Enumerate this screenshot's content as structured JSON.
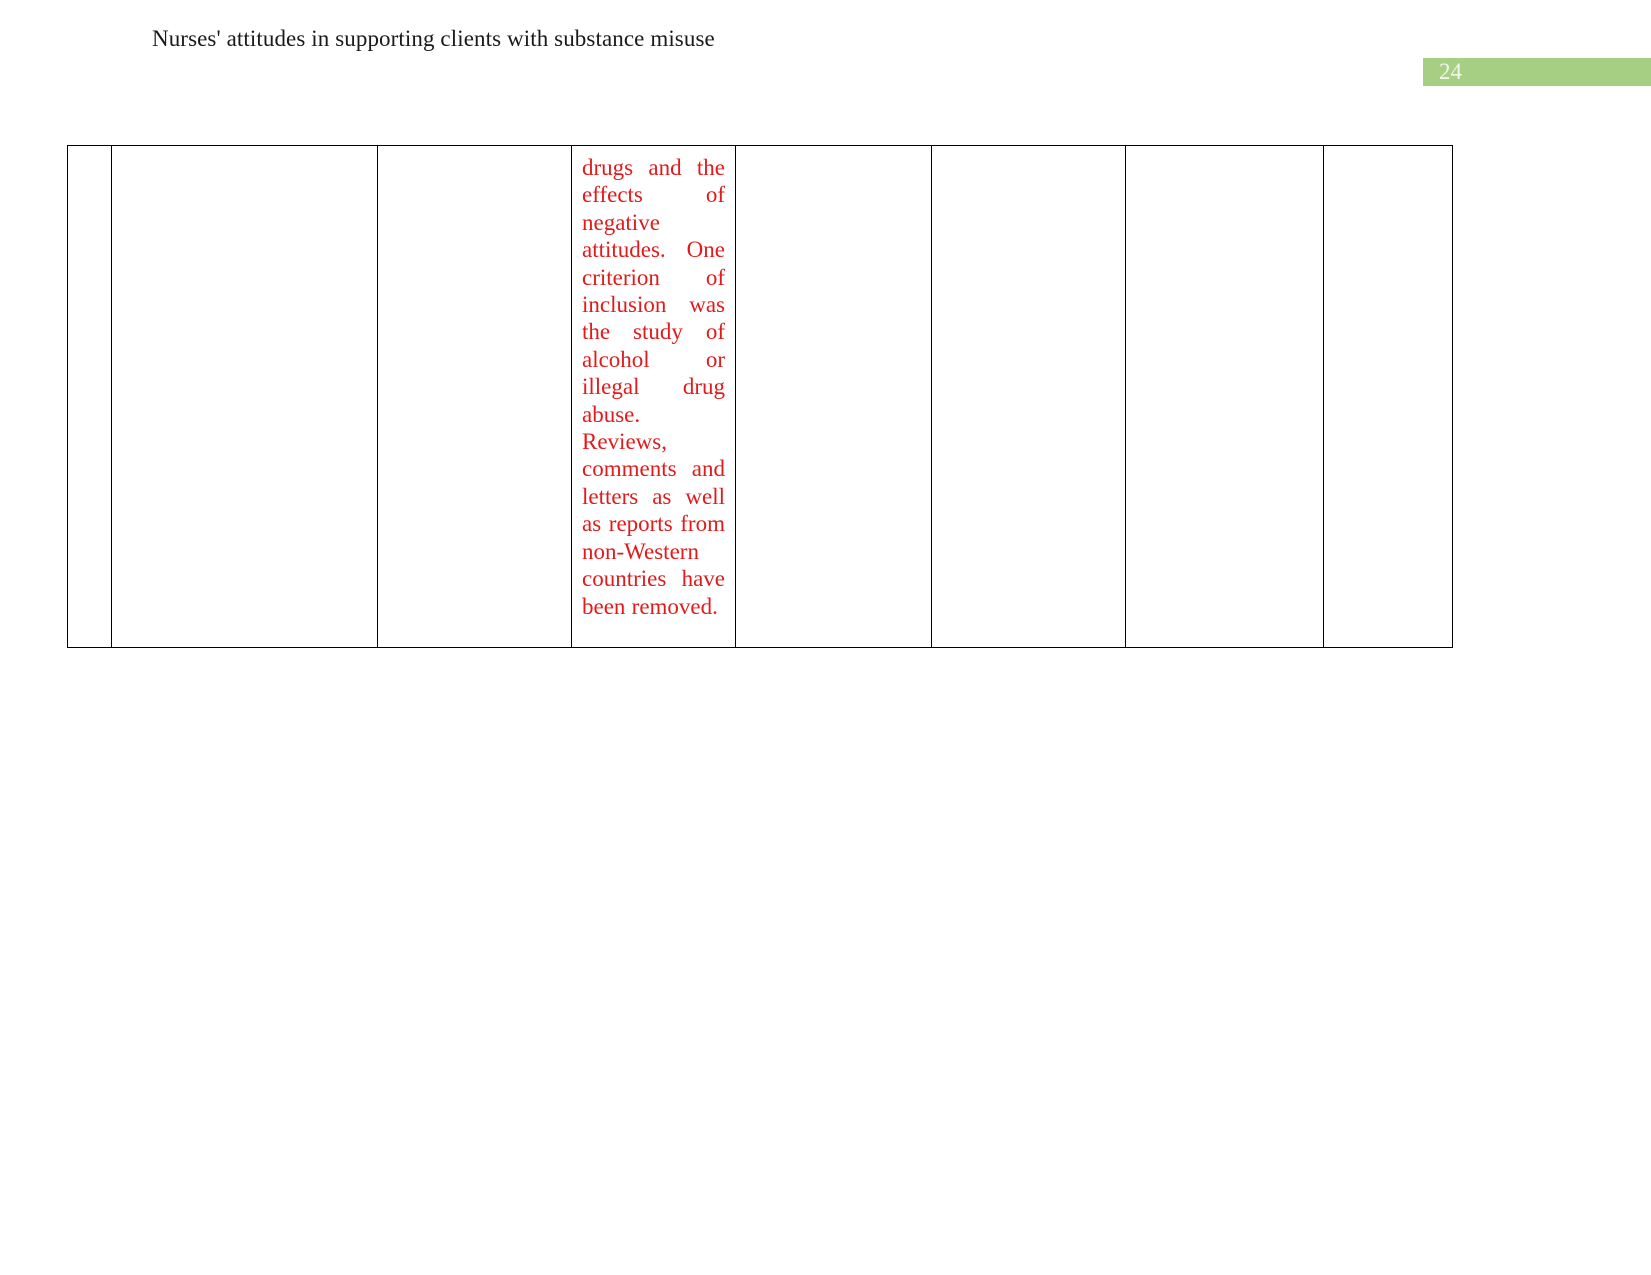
{
  "header": {
    "running_title": "Nurses' attitudes in supporting clients with substance misuse"
  },
  "page_badge": {
    "page_number": "24",
    "background_color": "#a6cf84",
    "text_color": "#f2f7ee"
  },
  "table": {
    "text_color": "#e01b1b",
    "border_color": "#000000",
    "columns": [
      {
        "id": "col-a",
        "label": ""
      },
      {
        "id": "col-b",
        "label": ""
      },
      {
        "id": "col-c",
        "label": ""
      },
      {
        "id": "col-d",
        "label": ""
      },
      {
        "id": "col-e",
        "label": ""
      },
      {
        "id": "col-f",
        "label": ""
      },
      {
        "id": "col-g",
        "label": ""
      },
      {
        "id": "col-h",
        "label": ""
      }
    ],
    "rows": [
      {
        "cells": [
          "",
          "",
          "",
          "drugs and the effects of negative attitudes. One criterion of inclusion was the study of alcohol or illegal drug abuse.",
          "",
          "",
          "",
          ""
        ],
        "continuation_cell": {
          "paragraph_1": "drugs and the effects of negative attitudes. One criterion of inclusion was the study of alcohol or illegal drug abuse.",
          "paragraph_2": "Reviews, comments and letters as well as reports from non-Western countries have been removed."
        }
      }
    ]
  }
}
